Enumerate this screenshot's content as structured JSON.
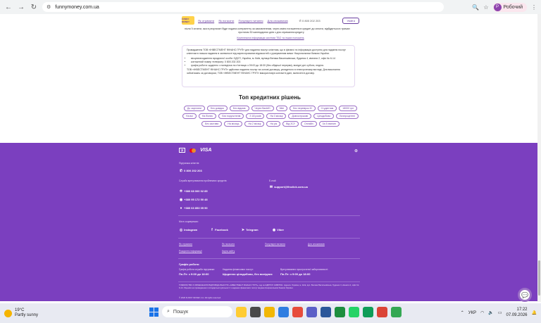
{
  "browser": {
    "url": "funnymoney.com.ua",
    "profile_initial": "Р",
    "profile_label": "Робочий"
  },
  "site_header": {
    "logo_text": "FUNNY MONEY",
    "nav": [
      "Як отримати",
      "Як погасити",
      "Популярні питання",
      "Для споживачів"
    ],
    "phone": "0 800 202 203",
    "enter_label": "Увійти"
  },
  "content": {
    "intro_line1": "після її сплати, яка в результаті буде подана контрагенту за замовленням, через зміни погашення в кредиті до сплати, відбудеться в триман",
    "intro_line2": "протягом 30 календарних днів з дня отримання кредиту",
    "intro_link": "Комплексна інформація системи ТБО та інших положень",
    "card_intro": "Провадження ТОВ «ІНВЕСТМЕНТ ФІНАНС ГРУП» для надання послуг клієнтам, що в фінансі та інформація доступно для надання послуг клієнтам в низька надання в залежності від зареєстрованих відомостей з урахуванням вимог Національним банком України.",
    "card_items": [
      "місцезнаходження юридичної особи: ОДСП, Україна, м. Київ, вулиця Велика Васильківська, будинок 4, кімната 2, офіс № 6-14",
      "контактний номер телефону: 0 800 202 203",
      "графік роботи: щоденно з понеділка по п'ятницю з 09:00 до 18:00 (без обідньої перерви), вихідні дні: субота, неділя."
    ],
    "card_outro": "ТОВ «ІНВЕСТМЕНТ ФІНАНС ГРУП» здійснює надання послуг на основі договору, укладеного в електронному вигляді. Для виконання зобов'язань за договором, ТОВ «ІНВЕСТМЕНТ ФІНАНС ГРУП» використовує контактні дані, включені в договір."
  },
  "top_solutions": {
    "title": "Топ кредитних рішень",
    "tags": [
      "До зарплати",
      "Без довідок",
      "Без відмов",
      "Через BankID",
      "Міні",
      "Без перевірок КІ",
      "Студентам",
      "18000 грн",
      "На всі",
      "На бізнес",
      "Без поручителів",
      "З 18 років",
      "На 3 місяці",
      "Довгострокові",
      "Цілодобово",
      "Безпроцентні",
      "Без застави",
      "На місяць",
      "На 2 місяці",
      "На рік",
      "Від ЗСУ",
      "Онлайн",
      "За 5 хвилин"
    ]
  },
  "footer": {
    "support_label": "Підтримка клієнтів",
    "support_phone": "0 800 202 203",
    "service_label": "Служба врегулювання проблемних кредитів",
    "service_phones": [
      "+380 68 000 02 85",
      "+380 95 172 50 48",
      "+380 63 853 05 90"
    ],
    "email_label": "E-mail:",
    "email": "support@finclick.com.ua",
    "social_label": "Ми в соцмережах:",
    "socials": [
      "Instagram",
      "Facebook",
      "Telegram",
      "Viber"
    ],
    "links": [
      "Як отримати",
      "Як погасити",
      "Популярні питання",
      "Для споживачів",
      "Розкриття інформації",
      "Карта сайту"
    ],
    "schedule_title": "Графік роботи",
    "schedule": [
      {
        "label": "Графік роботи служби підтримки:",
        "value": "Пн-Пт: з 9:00 до 18:00"
      },
      {
        "label": "Надання фінансових послуг:",
        "value": "Щоденно цілодобово, без вихідних"
      },
      {
        "label": "Врегулювання простроченої заборгованості:",
        "value": "Пн-Пт: з 9:00 до 18:00"
      }
    ],
    "legal": "ТОВАРИСТВО З ОБМЕЖЕНОЮ ВІДПОВІДАЛЬНІСТЮ «ІНВЕСТМЕНТ ФІНАНС ГРУП», код за ЄДРПОУ 44887091. Адреса: Україна, м. Київ, вул. Велика Васильківська, будинок 4, кімната 2, офіс № 6-14. Ліцензія на провадження господарської діяльності з надання фінансових послуг видана Національним банком України.",
    "copyright": "© 2026 FUNNY MONEY, Inc. All rights reserved."
  },
  "taskbar": {
    "temp": "19°C",
    "weather": "Partly sunny",
    "search_placeholder": "Пошук",
    "lang": "УКР",
    "time": "17:22",
    "date": "07.09.2026"
  },
  "colors": {
    "footer_bg": "#7b3fbf",
    "accent": "#6b3fa0"
  }
}
